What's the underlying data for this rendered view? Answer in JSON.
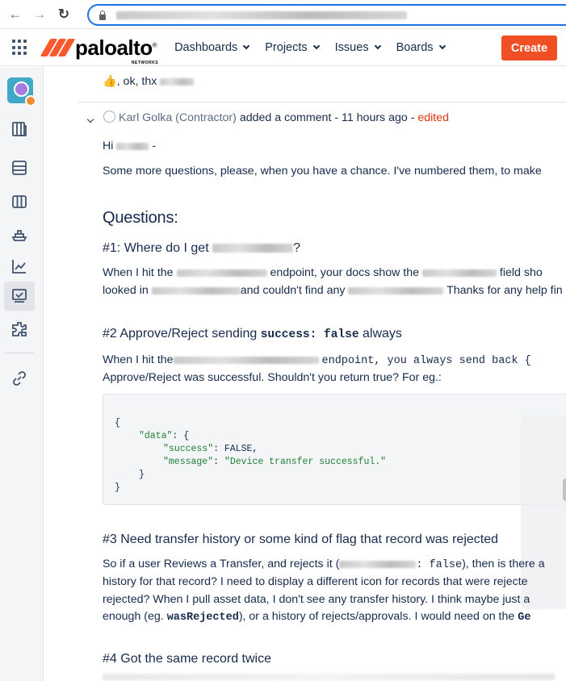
{
  "browser": {
    "back_glyph": "←",
    "forward_glyph": "→",
    "reload_glyph": "↻"
  },
  "header": {
    "logo_text": "paloalto",
    "logo_sub": "NETWORKS",
    "logo_mark": "®",
    "menu": [
      "Dashboards",
      "Projects",
      "Issues",
      "Boards"
    ],
    "create_label": "Create",
    "brand_color": "#fa582d",
    "create_color": "#f04e23"
  },
  "sidebar": {
    "icons": [
      "project-avatar-icon",
      "board-icon",
      "backlog-icon",
      "columns-icon",
      "ship-icon",
      "reports-icon",
      "review-icon",
      "components-icon",
      "link-icon"
    ]
  },
  "content": {
    "prev_comment": ", ok, thx",
    "thumbs_up": "👍",
    "collapse_glyph": "⌄",
    "comment_author": "Karl Golka (Contractor)",
    "comment_meta": "added a comment - 11 hours ago - ",
    "comment_edited": "edited",
    "greeting": "Hi",
    "greeting_dash": "-",
    "intro": "Some more questions, please, when you have a chance. I've numbered them, to make",
    "questions_heading": "Questions:",
    "q1_heading": "#1: Where do I get",
    "q1_heading_end": "?",
    "q1_line1_a": "When I hit the",
    "q1_line1_b": "endpoint, your docs show the",
    "q1_line1_c": "field sho",
    "q1_line2_a": "looked in",
    "q1_line2_b": "and couldn't find any",
    "q1_line2_c": "Thanks for any help fin",
    "q2_heading_a": "#2 Approve/Reject sending",
    "q2_heading_code": "success: false",
    "q2_heading_b": "always",
    "q2_line1_a": "When I hit the",
    "q2_line1_code": "endpoint, you always send back {",
    "q2_line2": "Approve/Reject was successful. Shouldn't you return true? For eg.:",
    "code": {
      "open": "{",
      "data_key": "\"data\"",
      "data_open": ": {",
      "success_key": "\"success\"",
      "success_val": ": FALSE,",
      "message_key": "\"message\"",
      "message_val": ": ",
      "message_str": "\"Device transfer successful.\"",
      "inner_close": "}",
      "close": "}"
    },
    "q3_heading": "#3 Need transfer history or some kind of flag that record was rejected",
    "q3_line1_a": "So if a user Reviews a Transfer, and rejects it (",
    "q3_line1_code": ": false",
    "q3_line1_b": "), then is there a",
    "q3_line2": "history for that record? I need to display a different icon for records that were rejecte",
    "q3_line3": "rejected? When I pull asset data, I don't see any transfer history. I think maybe just a",
    "q3_line4_a": "enough (eg.",
    "q3_line4_code": "wasRejected",
    "q3_line4_b": "), or a history of rejects/approvals. I would need on the",
    "q3_line4_code2": "Ge",
    "q4_heading": "#4 Got the same record twice"
  }
}
